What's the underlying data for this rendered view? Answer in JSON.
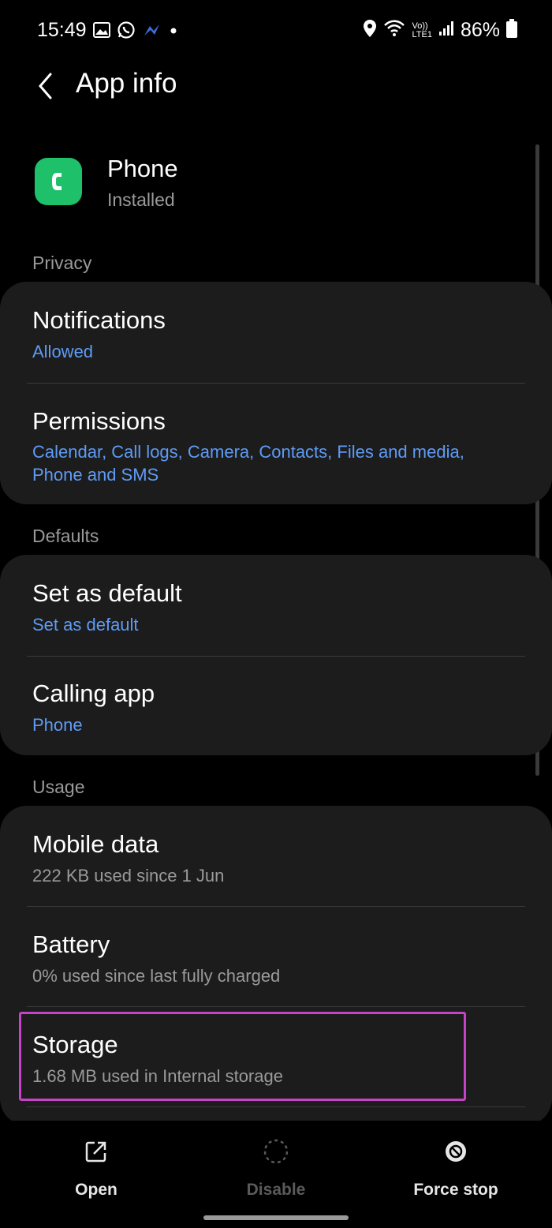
{
  "status_bar": {
    "time": "15:49",
    "battery": "86%",
    "network": "LTE1",
    "volte": "Vo))",
    "left_icons": [
      "gallery-icon",
      "whatsapp-icon",
      "messenger-icon",
      "dot-icon"
    ],
    "right_icons": [
      "location-icon",
      "wifi-icon",
      "volte-icon",
      "signal-icon",
      "battery-icon"
    ]
  },
  "header": {
    "title": "App info"
  },
  "app": {
    "name": "Phone",
    "status": "Installed",
    "icon_color": "#1ec06a"
  },
  "sections": {
    "privacy": {
      "label": "Privacy",
      "notifications": {
        "title": "Notifications",
        "sub": "Allowed"
      },
      "permissions": {
        "title": "Permissions",
        "sub_line1": "Calendar, Call logs, Camera, Contacts, Files and media,",
        "sub_line2": "Phone and SMS"
      }
    },
    "defaults": {
      "label": "Defaults",
      "set_default": {
        "title": "Set as default",
        "sub": "Set as default"
      },
      "calling_app": {
        "title": "Calling app",
        "sub": "Phone"
      }
    },
    "usage": {
      "label": "Usage",
      "mobile_data": {
        "title": "Mobile data",
        "sub": "222 KB used since 1 Jun"
      },
      "battery": {
        "title": "Battery",
        "sub": "0% used since last fully charged"
      },
      "storage": {
        "title": "Storage",
        "sub": "1.68 MB used in Internal storage"
      }
    }
  },
  "bottom_actions": {
    "open": "Open",
    "disable": "Disable",
    "force_stop": "Force stop"
  },
  "colors": {
    "accent_blue": "#5e9bf5",
    "highlight": "#c643c9",
    "card_bg": "#1c1c1c",
    "secondary_text": "#9a9a9a"
  }
}
